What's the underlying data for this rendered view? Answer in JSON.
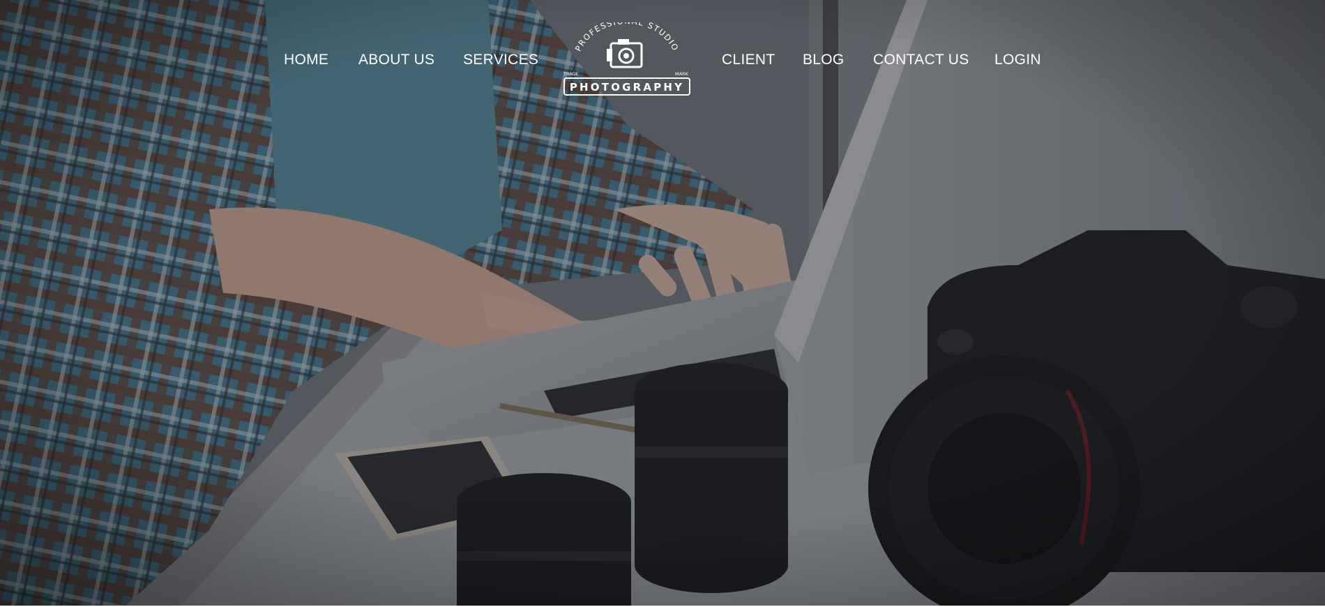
{
  "nav": {
    "left_items": [
      {
        "label": "HOME"
      },
      {
        "label": "ABOUT US"
      },
      {
        "label": "SERVICES"
      }
    ],
    "right_items": [
      {
        "label": "CLIENT"
      },
      {
        "label": "BLOG"
      },
      {
        "label": "CONTACT US"
      },
      {
        "label": "LOGIN"
      }
    ]
  },
  "logo": {
    "arc_text": "PROFESSIONAL STUDIO",
    "left_mark": "TRADE",
    "right_mark": "MARK",
    "banner": "PHOTOGRAPHY",
    "icon": "camera-icon"
  },
  "hero": {
    "scene": "photographer-working-on-laptop-with-camera-and-lenses"
  },
  "colors": {
    "nav_text": "#ffffff",
    "overlay": "#1c1f24"
  }
}
